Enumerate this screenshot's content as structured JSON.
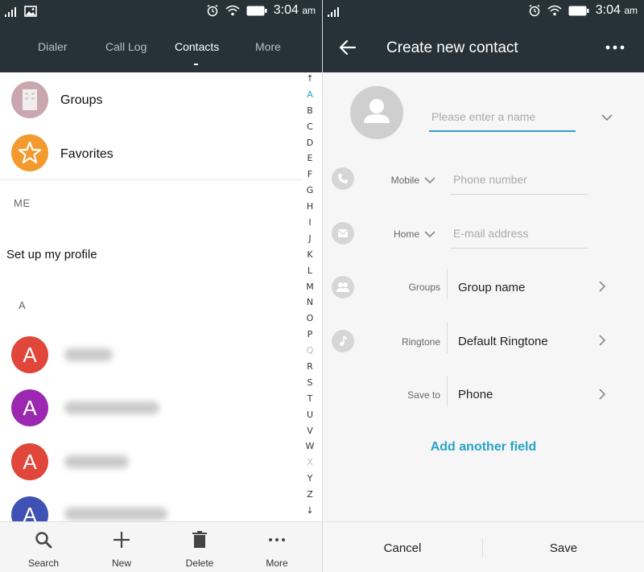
{
  "status_bar": {
    "time": "3:04",
    "ampm": "am"
  },
  "left": {
    "tabs": [
      {
        "label": "Dialer"
      },
      {
        "label": "Call Log"
      },
      {
        "label": "Contacts"
      },
      {
        "label": "More"
      }
    ],
    "groups_label": "Groups",
    "favorites_label": "Favorites",
    "me_label": "ME",
    "profile_label": "Set up my profile",
    "section_a": "A",
    "contacts": [
      {
        "initial": "A",
        "color": "#e0463a"
      },
      {
        "initial": "A",
        "color": "#9c27b0"
      },
      {
        "initial": "A",
        "color": "#e0463a"
      },
      {
        "initial": "A",
        "color": "#3f51b5"
      }
    ],
    "alphabet": [
      "↑",
      "A",
      "B",
      "C",
      "D",
      "E",
      "F",
      "G",
      "H",
      "I",
      "J",
      "K",
      "L",
      "M",
      "N",
      "O",
      "P",
      "Q",
      "R",
      "S",
      "T",
      "U",
      "V",
      "W",
      "X",
      "Y",
      "Z",
      "↓"
    ],
    "bottom": [
      {
        "label": "Search",
        "icon": "search-icon"
      },
      {
        "label": "New",
        "icon": "plus-icon"
      },
      {
        "label": "Delete",
        "icon": "trash-icon"
      },
      {
        "label": "More",
        "icon": "more-icon"
      }
    ]
  },
  "right": {
    "title": "Create new contact",
    "name_placeholder": "Please enter a name",
    "phone_type": "Mobile",
    "phone_placeholder": "Phone number",
    "email_type": "Home",
    "email_placeholder": "E-mail address",
    "groups_label": "Groups",
    "groups_value": "Group name",
    "ringtone_label": "Ringtone",
    "ringtone_value": "Default Ringtone",
    "saveto_label": "Save to",
    "saveto_value": "Phone",
    "add_field": "Add another field",
    "cancel": "Cancel",
    "save": "Save"
  },
  "colors": {
    "header": "#263238",
    "accent": "#29a3c9",
    "favorites": "#f39a2e"
  }
}
